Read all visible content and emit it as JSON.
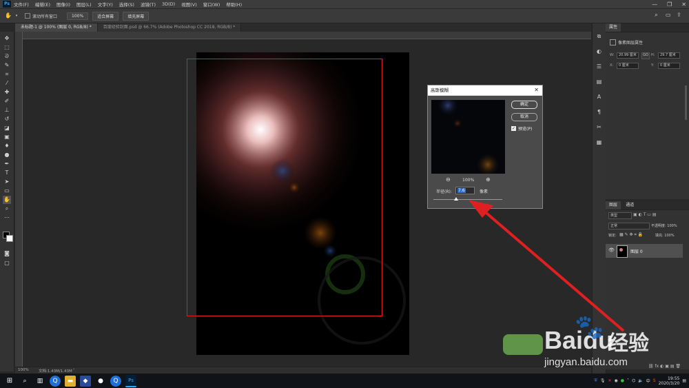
{
  "menu": {
    "items": [
      "文件(F)",
      "编辑(E)",
      "图像(I)",
      "图层(L)",
      "文字(Y)",
      "选择(S)",
      "滤镜(T)",
      "3D(D)",
      "视图(V)",
      "窗口(W)",
      "帮助(H)"
    ]
  },
  "options": {
    "scroll_all_label": "滚动所有窗口",
    "zoom_label": "100%",
    "fit_screen_label": "适合屏幕",
    "fill_screen_label": "填充屏幕"
  },
  "tabs": [
    {
      "label": "未标题-1 @ 100% (图层 0, RGB/8) *"
    },
    {
      "label": "百度经验封面.psd @ 66.7% (Adobe Photoshop CC 2018, RGB/8) *"
    }
  ],
  "status": {
    "zoom": "100%",
    "doc_info": "文档:1.43M/1.43M"
  },
  "properties": {
    "tab_label": "属性",
    "section_label": "像素图层属性",
    "w_label": "W:",
    "w_value": "20.99 厘米",
    "link_label": "GO",
    "h_label": "H:",
    "h_value": "29.7 厘米",
    "x_label": "X:",
    "x_value": "0 厘米",
    "y_label": "Y:",
    "y_value": "0 厘米"
  },
  "layers": {
    "tab_layers": "图层",
    "tab_channels": "通道",
    "kind_label": "类型",
    "mode_label": "正常",
    "opacity_label": "不透明度: 100%",
    "lock_label": "锁定:",
    "fill_label": "填充: 100%",
    "layer_name": "图层 0"
  },
  "dialog": {
    "title": "高斯模糊",
    "ok_label": "确定",
    "cancel_label": "取消",
    "preview_label": "预览(P)",
    "zoom_value": "100%",
    "radius_label": "半径(R):",
    "radius_value": "7.6",
    "unit_label": "像素"
  },
  "taskbar": {
    "time": "19:55",
    "date": "2020/3/20"
  },
  "watermark": {
    "brand": "Baidu",
    "brand_suffix": "经验",
    "url": "jingyan.baidu.com"
  },
  "colors": {
    "accent_red": "#e02020",
    "ps_blue": "#31a8ff"
  }
}
